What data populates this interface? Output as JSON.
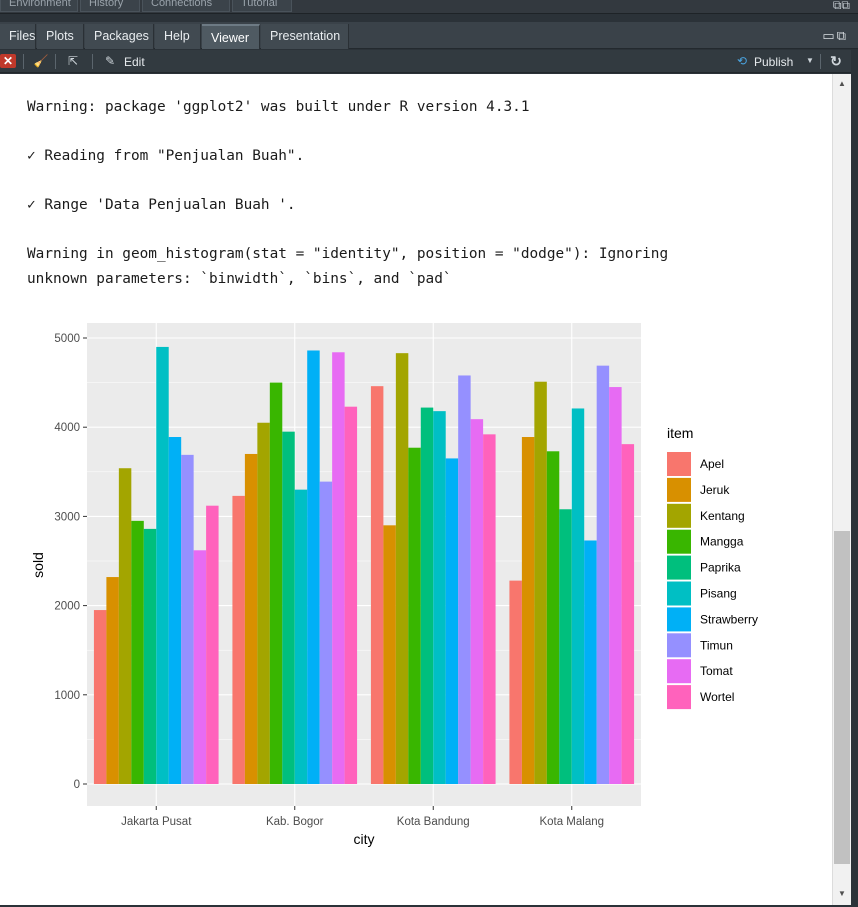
{
  "tabs": [
    "Files",
    "Plots",
    "Packages",
    "Help",
    "Viewer",
    "Presentation"
  ],
  "active_tab": "Viewer",
  "top_tabs": [
    "Environment",
    "History",
    "Connections",
    "Tutorial"
  ],
  "toolbar": {
    "edit_label": "Edit",
    "publish_label": "Publish"
  },
  "console": [
    "Warning: package 'ggplot2' was built under R version 4.3.1",
    "✓ Reading from \"Penjualan Buah\".",
    "✓ Range 'Data Penjualan Buah '.",
    "Warning in geom_histogram(stat = \"identity\", position = \"dodge\"): Ignoring",
    "unknown parameters: `binwidth`, `bins`, and `pad`"
  ],
  "chart_data": {
    "type": "bar",
    "xlabel": "city",
    "ylabel": "sold",
    "legend_title": "item",
    "legend_placement": "right",
    "ylim": [
      0,
      5000
    ],
    "yticks": [
      0,
      1000,
      2000,
      3000,
      4000,
      5000
    ],
    "grid": true,
    "categories": [
      "Jakarta Pusat",
      "Kab. Bogor",
      "Kota Bandung",
      "Kota Malang"
    ],
    "series": [
      {
        "name": "Apel",
        "color": "#F8766D",
        "values": [
          1950,
          3230,
          4460,
          2280
        ]
      },
      {
        "name": "Jeruk",
        "color": "#D89000",
        "values": [
          2320,
          3700,
          2900,
          3890
        ]
      },
      {
        "name": "Kentang",
        "color": "#A3A500",
        "values": [
          3540,
          4050,
          4830,
          4510
        ]
      },
      {
        "name": "Mangga",
        "color": "#39B600",
        "values": [
          2950,
          4500,
          3770,
          3730
        ]
      },
      {
        "name": "Paprika",
        "color": "#00BF7D",
        "values": [
          2860,
          3950,
          4220,
          3080
        ]
      },
      {
        "name": "Pisang",
        "color": "#00BFC4",
        "values": [
          4900,
          3300,
          4180,
          4210
        ]
      },
      {
        "name": "Strawberry",
        "color": "#00B0F6",
        "values": [
          3890,
          4860,
          3650,
          2730
        ]
      },
      {
        "name": "Timun",
        "color": "#9590FF",
        "values": [
          3690,
          3390,
          4580,
          4690
        ]
      },
      {
        "name": "Tomat",
        "color": "#E76BF3",
        "values": [
          2620,
          4840,
          4090,
          4450
        ]
      },
      {
        "name": "Wortel",
        "color": "#FF62BC",
        "values": [
          3120,
          4230,
          3920,
          3810
        ]
      }
    ]
  }
}
